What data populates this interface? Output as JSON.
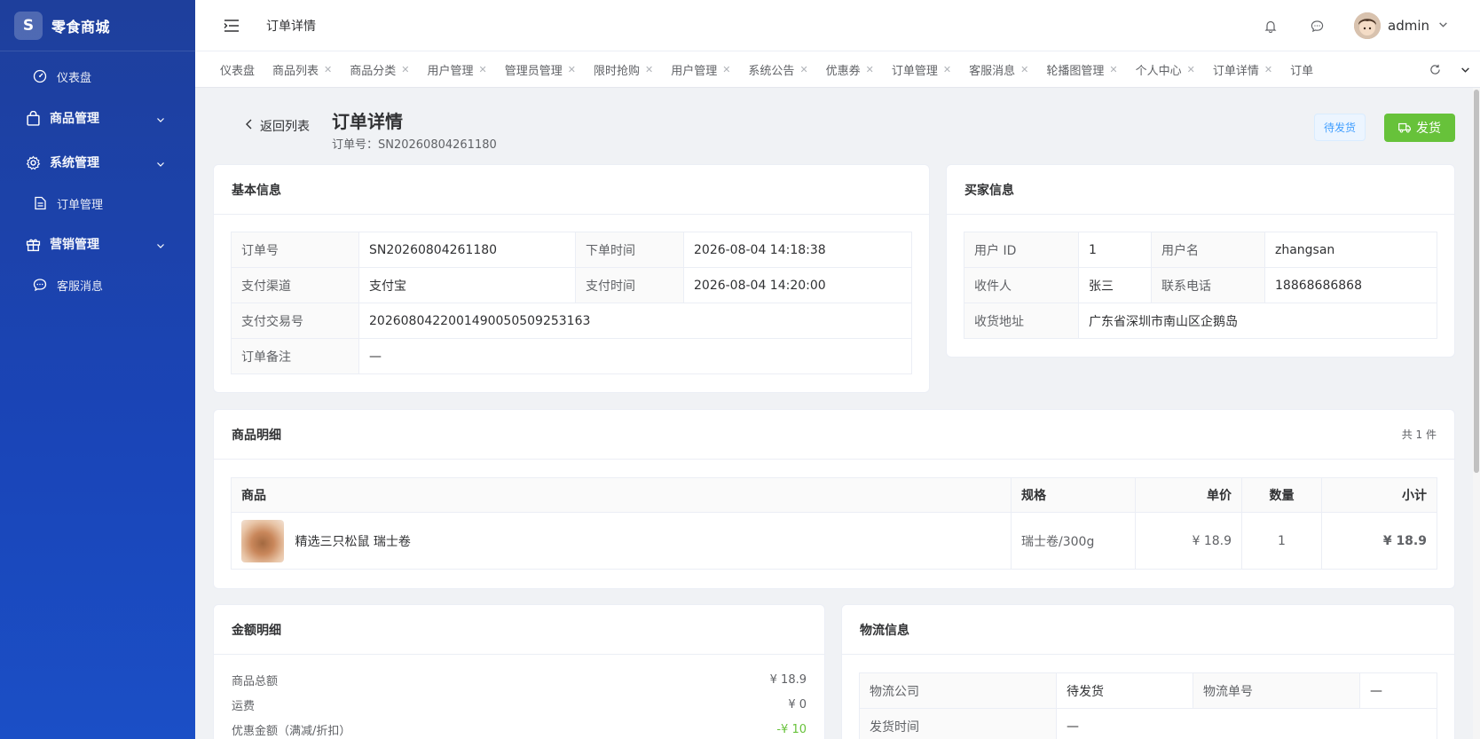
{
  "app": {
    "logo_letter": "S",
    "name": "零食商城"
  },
  "sidebar": {
    "items": [
      {
        "label": "仪表盘",
        "icon": "dashboard-icon"
      },
      {
        "label": "商品管理",
        "icon": "bag-icon"
      },
      {
        "label": "系统管理",
        "icon": "gear-icon"
      },
      {
        "label": "订单管理",
        "icon": "document-icon"
      },
      {
        "label": "营销管理",
        "icon": "gift-icon"
      },
      {
        "label": "客服消息",
        "icon": "chat-icon"
      }
    ]
  },
  "header": {
    "title": "订单详情",
    "username": "admin"
  },
  "tabs": [
    "仪表盘",
    "商品列表",
    "商品分类",
    "用户管理",
    "管理员管理",
    "限时抢购",
    "用户管理",
    "系统公告",
    "优惠券",
    "订单管理",
    "客服消息",
    "轮播图管理",
    "个人中心",
    "订单详情",
    "订单"
  ],
  "page": {
    "back_label": "返回列表",
    "title": "订单详情",
    "order_no_line": "订单号：SN20260804261180",
    "status": "待发货",
    "ship_label": "发货"
  },
  "basic": {
    "title": "基本信息",
    "order_no_label": "订单号",
    "order_no": "SN20260804261180",
    "order_time_label": "下单时间",
    "order_time": "2026-08-04 14:18:38",
    "pay_channel_label": "支付渠道",
    "pay_channel": "支付宝",
    "pay_time_label": "支付时间",
    "pay_time": "2026-08-04 14:20:00",
    "txn_label": "支付交易号",
    "txn": "2026080422001490050509253163",
    "remark_label": "订单备注",
    "remark": "—"
  },
  "buyer": {
    "title": "买家信息",
    "uid_label": "用户 ID",
    "uid": "1",
    "uname_label": "用户名",
    "uname": "zhangsan",
    "receiver_label": "收件人",
    "receiver": "张三",
    "phone_label": "联系电话",
    "phone": "18868686868",
    "address_label": "收货地址",
    "address": "广东省深圳市南山区企鹅岛"
  },
  "goods": {
    "title": "商品明细",
    "count": "共 1 件",
    "headers": {
      "product": "商品",
      "spec": "规格",
      "price": "单价",
      "qty": "数量",
      "subtotal": "小计"
    },
    "row": {
      "name": "精选三只松鼠 瑞士卷",
      "spec": "瑞士卷/300g",
      "price": "¥ 18.9",
      "qty": "1",
      "subtotal": "¥ 18.9"
    }
  },
  "amount": {
    "title": "金额明细",
    "goods_total_label": "商品总额",
    "goods_total": "¥ 18.9",
    "freight_label": "运费",
    "freight": "¥ 0",
    "discount_label": "优惠金额（满减/折扣）",
    "discount": "-¥ 10"
  },
  "logistics": {
    "title": "物流信息",
    "company_label": "物流公司",
    "company": "待发货",
    "tracking_label": "物流单号",
    "tracking": "—",
    "ship_time_label": "发货时间",
    "ship_time": "—"
  },
  "colors": {
    "sidebar": "#1e3f9c",
    "success": "#67c23a",
    "danger": "#f56c6c",
    "primary": "#409eff"
  }
}
